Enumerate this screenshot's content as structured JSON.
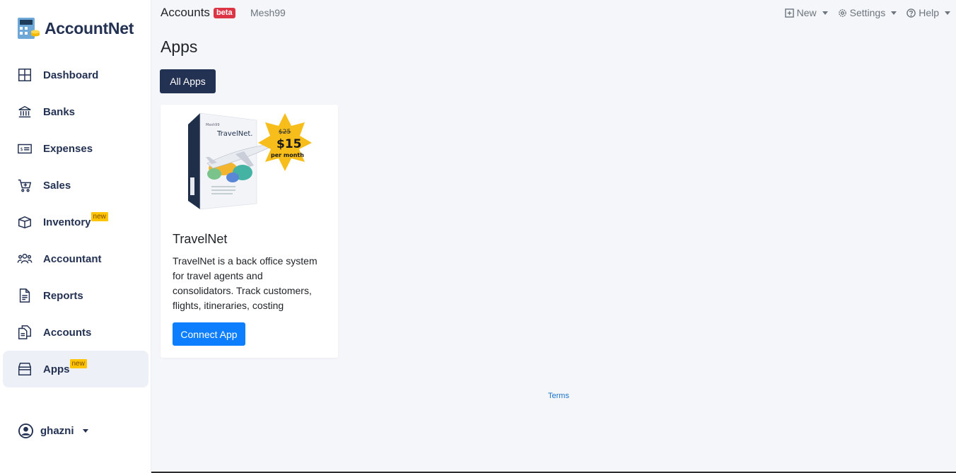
{
  "brand": {
    "name": "AccountNet"
  },
  "sidebar": {
    "items": [
      {
        "label": "Dashboard",
        "icon": "dashboard-icon",
        "badge": ""
      },
      {
        "label": "Banks",
        "icon": "bank-icon",
        "badge": ""
      },
      {
        "label": "Expenses",
        "icon": "expenses-icon",
        "badge": ""
      },
      {
        "label": "Sales",
        "icon": "cart-icon",
        "badge": ""
      },
      {
        "label": "Inventory",
        "icon": "box-icon",
        "badge": "new"
      },
      {
        "label": "Accountant",
        "icon": "people-icon",
        "badge": ""
      },
      {
        "label": "Reports",
        "icon": "report-icon",
        "badge": ""
      },
      {
        "label": "Accounts",
        "icon": "copy-icon",
        "badge": ""
      },
      {
        "label": "Apps",
        "icon": "shop-icon",
        "badge": "new",
        "active": true
      }
    ],
    "user": "ghazni"
  },
  "header": {
    "section": "Accounts",
    "beta": "beta",
    "org": "Mesh99",
    "menu": {
      "new": "New",
      "settings": "Settings",
      "help": "Help"
    }
  },
  "main": {
    "title": "Apps",
    "tab": "All Apps",
    "card": {
      "title": "TravelNet",
      "description": "TravelNet is a back office system for travel agents and consolidators. Track customers, flights, itineraries, costing",
      "button": "Connect App",
      "image": {
        "product": "TravelNet.",
        "old_price": "$25",
        "price": "$15",
        "period": "per month"
      }
    }
  },
  "footer": {
    "terms": "Terms"
  },
  "colors": {
    "navy": "#233152",
    "primary": "#0d7efe",
    "badge": "#ffc400",
    "beta": "#dc3545"
  }
}
